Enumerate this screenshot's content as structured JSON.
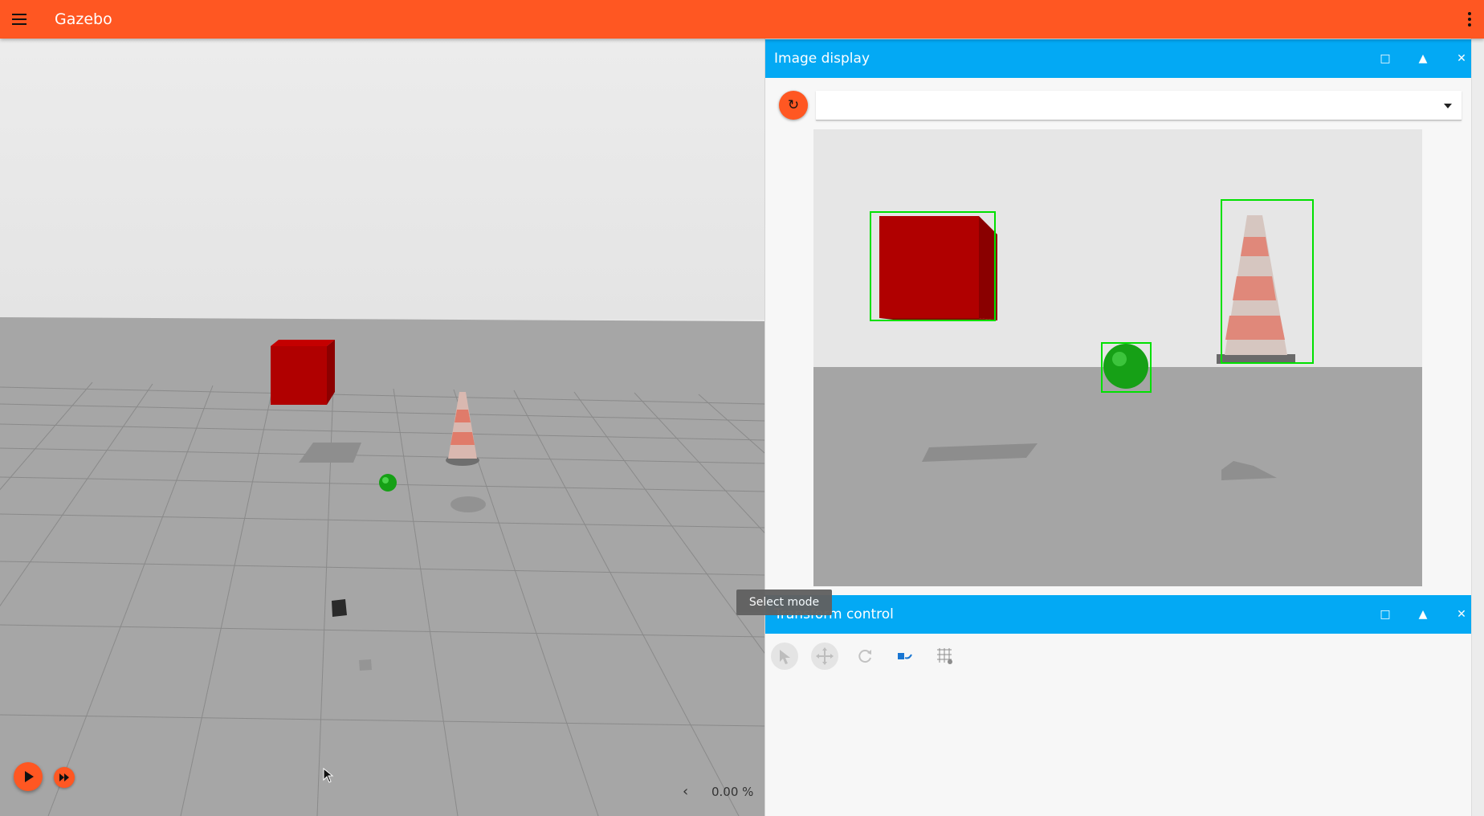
{
  "app": {
    "title": "Gazebo",
    "menu_icon": "hamburger-menu-icon",
    "more_icon": "more-vert-icon",
    "accent_color": "#ff5722",
    "panel_header_color": "#03a9f4"
  },
  "image_display": {
    "title": "Image display",
    "refresh_icon": "refresh-icon",
    "refresh_glyph": "↻",
    "topic_value": "",
    "window_buttons": {
      "maximize": "□",
      "collapse": "▲",
      "close": "✕"
    },
    "detections": [
      {
        "label": "red box",
        "color": "#00e000"
      },
      {
        "label": "green sphere",
        "color": "#00e000"
      },
      {
        "label": "construction cone",
        "color": "#00e000"
      }
    ]
  },
  "transform_control": {
    "title": "Transform control",
    "tooltip": "Select mode",
    "window_buttons": {
      "maximize": "□",
      "collapse": "▲",
      "close": "✕"
    },
    "tools": [
      "select-mode-icon",
      "translate-mode-icon",
      "rotate-mode-icon",
      "snap-icon",
      "grid-snap-icon"
    ]
  },
  "playback": {
    "play_icon": "play-icon",
    "step_icon": "fast-forward-icon",
    "rtf_arrow": "‹",
    "real_time_factor": "0.00 %"
  }
}
